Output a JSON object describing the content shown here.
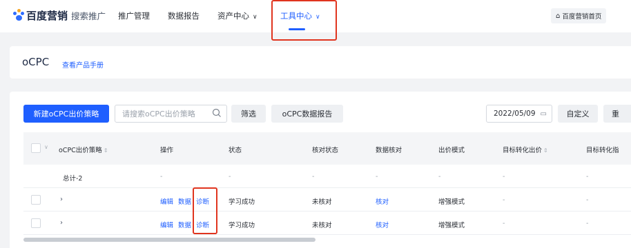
{
  "nav": {
    "brand": "百度营销",
    "brand_sub": "搜索推广",
    "items": [
      {
        "label": "推广管理"
      },
      {
        "label": "数据报告"
      },
      {
        "label": "资产中心"
      },
      {
        "label": "工具中心"
      }
    ],
    "home_label": "百度营销首页"
  },
  "page": {
    "title": "oCPC",
    "manual_link": "查看产品手册"
  },
  "toolbar": {
    "new_label": "新建oCPC出价策略",
    "search_placeholder": "请搜索oCPC出价策略",
    "filter_label": "筛选",
    "report_label": "oCPC数据报告",
    "date": "2022/05/09",
    "custom_label": "自定义",
    "reset_label": "重"
  },
  "table": {
    "headers": {
      "name": "oCPC出价策略",
      "action": "操作",
      "status": "状态",
      "verify_status": "核对状态",
      "data_verify": "数据核对",
      "bid_mode": "出价模式",
      "target_bid": "目标转化出价",
      "target_metric": "目标转化指"
    },
    "total": {
      "name": "总计-2",
      "action": "-",
      "status": "-",
      "verify_status": "-",
      "data_verify": "-",
      "bid_mode": "-",
      "target_bid": "-",
      "target_metric": "-"
    },
    "rows": [
      {
        "edit": "编辑",
        "data": "数据",
        "diagnose": "诊断",
        "status": "学习成功",
        "verify_status": "未核对",
        "data_verify": "核对",
        "bid_mode": "增强模式",
        "target_bid": "-",
        "target_metric": "-"
      },
      {
        "edit": "编辑",
        "data": "数据",
        "diagnose": "诊断",
        "status": "学习成功",
        "verify_status": "未核对",
        "data_verify": "核对",
        "bid_mode": "增强模式",
        "target_bid": "-",
        "target_metric": "-"
      }
    ]
  },
  "colors": {
    "accent": "#1f5fff",
    "highlight": "#e0341e"
  }
}
